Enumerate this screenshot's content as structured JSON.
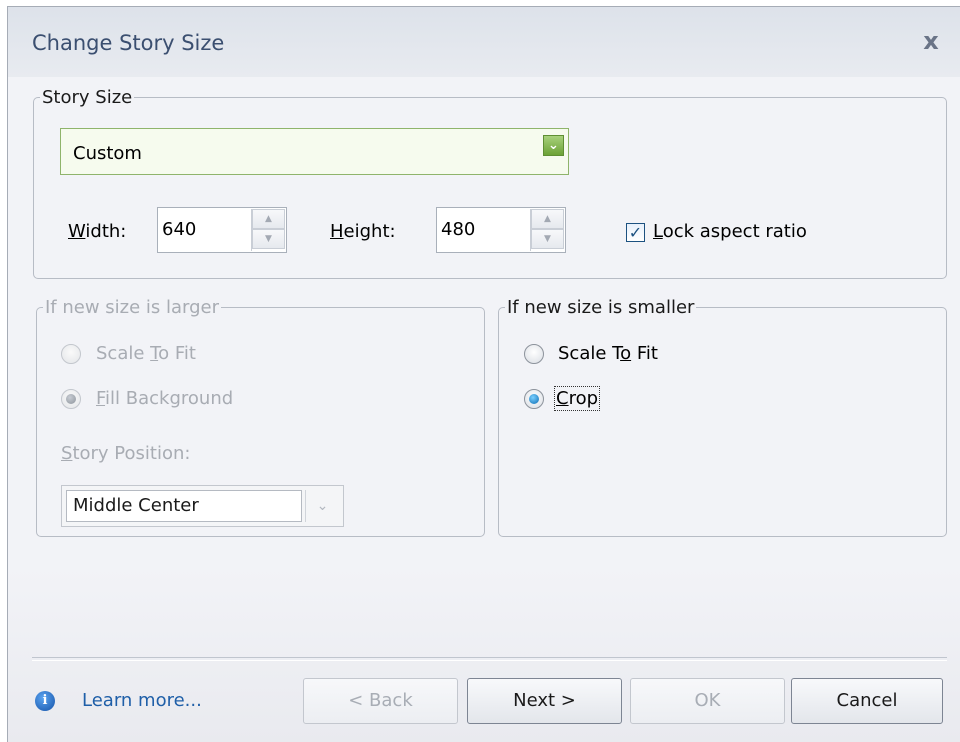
{
  "window": {
    "title": "Change Story Size",
    "close_glyph": "x"
  },
  "story_size": {
    "legend": "Story Size",
    "preset": "Custom",
    "width_label": "Width:",
    "width_value": "640",
    "height_label": "Height:",
    "height_value": "480",
    "lock_label": "Lock aspect ratio",
    "lock_checked": true
  },
  "larger": {
    "legend": "If new size is larger",
    "option_scale": "Scale To Fit",
    "option_fill": "Fill Background",
    "position_label": "Story Position:",
    "position_value": "Middle Center",
    "enabled": false
  },
  "smaller": {
    "legend": "If new size is smaller",
    "option_scale": "Scale To Fit",
    "option_crop": "Crop",
    "selected": "Crop"
  },
  "footer": {
    "learn_more": "Learn more...",
    "back": "< Back",
    "next": "Next >",
    "ok": "OK",
    "cancel": "Cancel"
  },
  "icons": {
    "info": "info-icon",
    "close": "close-icon",
    "dropdown": "chevron-down-icon",
    "spin": "spin-arrows-icon"
  }
}
